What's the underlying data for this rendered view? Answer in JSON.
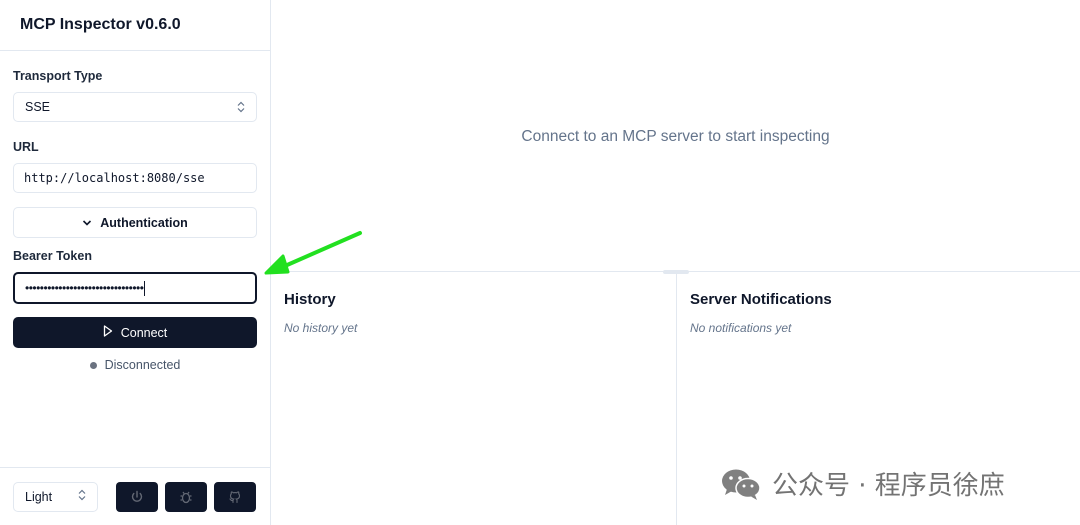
{
  "app": {
    "title": "MCP Inspector v0.6.0"
  },
  "sidebar": {
    "transport_label": "Transport Type",
    "transport_value": "SSE",
    "url_label": "URL",
    "url_value": "http://localhost:8080/sse",
    "auth_button_label": "Authentication",
    "token_label": "Bearer Token",
    "token_value": "••••••••••••••••••••••••••••••••",
    "connect_label": "Connect",
    "status_text": "Disconnected",
    "theme_value": "Light"
  },
  "main": {
    "placeholder": "Connect to an MCP server to start inspecting",
    "history_title": "History",
    "history_empty": "No history yet",
    "notifications_title": "Server Notifications",
    "notifications_empty": "No notifications yet"
  },
  "watermark": {
    "text": "公众号 · 程序员徐庶"
  },
  "icons": {
    "select_chevrons": "chevron-up-down-icon",
    "auth_chevron": "chevron-down-icon",
    "connect_icon": "play-icon",
    "footer_icons": [
      "power-icon",
      "bug-icon",
      "github-icon"
    ],
    "annotation": "green-arrow-icon",
    "watermark_icon": "wechat-icon"
  },
  "colors": {
    "primary": "#0f172a",
    "border": "#e2e8f0",
    "muted_text": "#64748b",
    "annotation_arrow": "#22e020"
  }
}
